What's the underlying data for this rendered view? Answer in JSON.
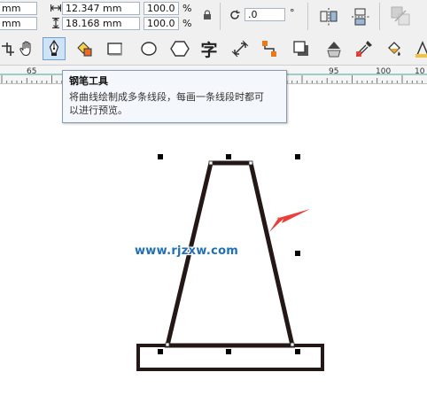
{
  "property_bar": {
    "pos_x_value": "mm",
    "pos_y_value": "mm",
    "width_value": "12.347 mm",
    "height_value": "18.168 mm",
    "scale_x_value": "100.0",
    "scale_y_value": "100.0",
    "percent_symbol_1": "%",
    "percent_symbol_2": "%",
    "rotation_value": ".0",
    "degree_symbol": "°"
  },
  "toolbox": {
    "active_tool": "pen-tool",
    "text_tool_glyph": "字"
  },
  "ruler": {
    "labels": [
      "65",
      "95",
      "100",
      "10"
    ]
  },
  "tooltip": {
    "title": "钢笔工具",
    "line1": "将曲线绘制成多条线段，每画一条线段时都可",
    "line2": "以进行预览。"
  },
  "canvas": {
    "watermark": "www.rjzxw.com",
    "shape_stroke_color": "#231815",
    "arrow_color": "#e8413c",
    "handle_color": "#000000"
  }
}
